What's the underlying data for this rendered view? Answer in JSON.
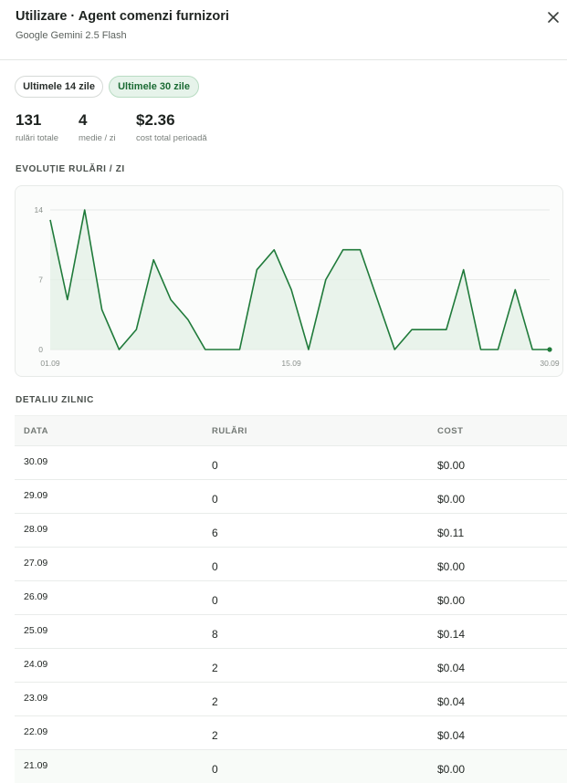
{
  "header": {
    "title": "Utilizare · Agent comenzi furnizori",
    "subtitle": "Google Gemini 2.5 Flash"
  },
  "tabs": [
    {
      "label": "Ultimele 14 zile",
      "active": false
    },
    {
      "label": "Ultimele 30 zile",
      "active": true
    }
  ],
  "stats": [
    {
      "value": "131",
      "label": "rulări totale"
    },
    {
      "value": "4",
      "label": "medie / zi"
    },
    {
      "value": "$2.36",
      "label": "cost total perioadă"
    }
  ],
  "chart_section_title": "EVOLUȚIE RULĂRI / ZI",
  "chart_data": {
    "type": "area",
    "x": [
      "01.09",
      "02.09",
      "03.09",
      "04.09",
      "05.09",
      "06.09",
      "07.09",
      "08.09",
      "09.09",
      "10.09",
      "11.09",
      "12.09",
      "13.09",
      "14.09",
      "15.09",
      "16.09",
      "17.09",
      "18.09",
      "19.09",
      "20.09",
      "21.09",
      "22.09",
      "23.09",
      "24.09",
      "25.09",
      "26.09",
      "27.09",
      "28.09",
      "29.09",
      "30.09"
    ],
    "values": [
      13,
      5,
      14,
      4,
      0,
      2,
      9,
      5,
      3,
      0,
      0,
      0,
      8,
      10,
      6,
      0,
      7,
      10,
      10,
      5,
      0,
      2,
      2,
      2,
      8,
      0,
      0,
      6,
      0,
      0
    ],
    "x_tick_labels": [
      "01.09",
      "15.09",
      "30.09"
    ],
    "y_ticks": [
      0,
      7,
      14
    ],
    "ylim": [
      0,
      14
    ],
    "grid": true,
    "line_color": "#1f7a3a",
    "fill_color": "#e3f0e6"
  },
  "table_section_title": "DETALIU ZILNIC",
  "table": {
    "columns": [
      "DATA",
      "RULĂRI",
      "COST"
    ],
    "rows": [
      [
        "30.09",
        "0",
        "$0.00"
      ],
      [
        "29.09",
        "0",
        "$0.00"
      ],
      [
        "28.09",
        "6",
        "$0.11"
      ],
      [
        "27.09",
        "0",
        "$0.00"
      ],
      [
        "26.09",
        "0",
        "$0.00"
      ],
      [
        "25.09",
        "8",
        "$0.14"
      ],
      [
        "24.09",
        "2",
        "$0.04"
      ],
      [
        "23.09",
        "2",
        "$0.04"
      ],
      [
        "22.09",
        "2",
        "$0.04"
      ],
      [
        "21.09",
        "0",
        "$0.00"
      ]
    ]
  }
}
